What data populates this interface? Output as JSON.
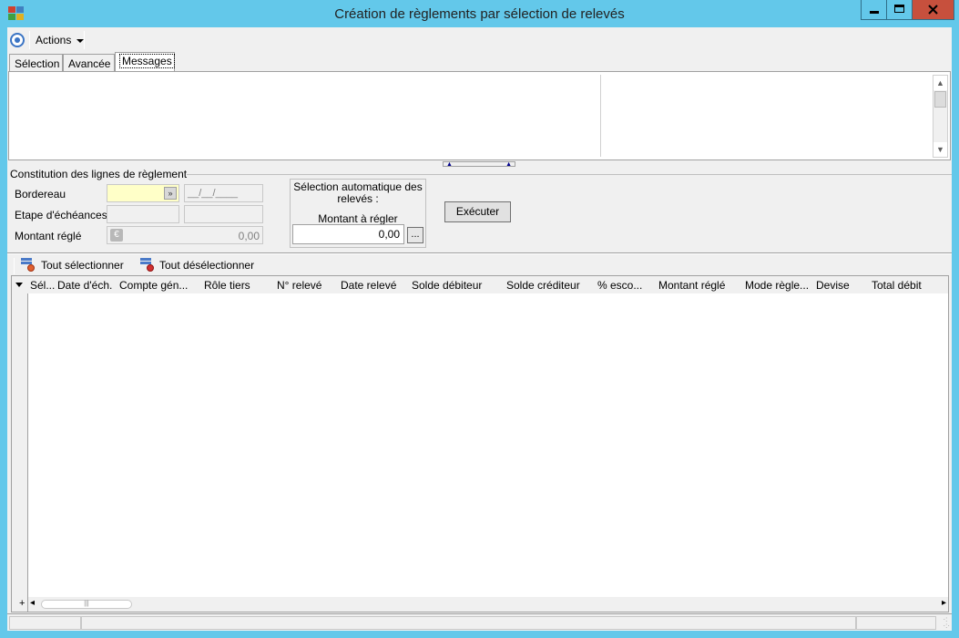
{
  "window": {
    "title": "Création de règlements par sélection de relevés",
    "minimize_glyph": "–",
    "maximize_glyph": "□",
    "close_glyph": "✕"
  },
  "toolbar": {
    "actions_label": "Actions"
  },
  "tabs": [
    {
      "label": "Sélection"
    },
    {
      "label": "Avancée"
    },
    {
      "label": "Messages"
    }
  ],
  "form": {
    "group_title": "Constitution des lignes de règlement",
    "bordereau_label": "Bordereau",
    "date_placeholder": "__/__/____",
    "etape_label": "Etape d'échéances",
    "montant_regle_label": "Montant réglé",
    "montant_regle_value": "0,00",
    "auto_selection_title": "Sélection automatique des relevés :",
    "montant_a_regler_label": "Montant à régler",
    "montant_a_regler_value": "0,00",
    "dots_label": "...",
    "execute_label": "Exécuter"
  },
  "grid_toolbar": {
    "select_all": "Tout sélectionner",
    "deselect_all": "Tout désélectionner"
  },
  "grid": {
    "columns": [
      "Sél...",
      "Date d'éch.",
      "Compte gén...",
      "Rôle tiers",
      "N° relevé",
      "Date relevé",
      "Solde débiteur",
      "Solde créditeur",
      "% esco...",
      "Montant réglé",
      "Mode règle...",
      "Devise",
      "Total débit"
    ],
    "add_row_symbol": "+"
  },
  "icons": {
    "app": "app-icon",
    "toolbar": "target-icon",
    "euro": "euro-icon",
    "dropdown": "double-chevron-down-icon"
  }
}
